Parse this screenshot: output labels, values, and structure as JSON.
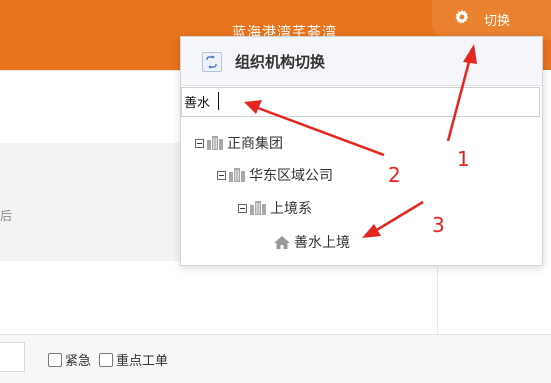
{
  "header": {
    "project_title": "蓝海港湾芊荟湾",
    "switch_label": "切换"
  },
  "background": {
    "left_text": "后",
    "checkboxes": [
      {
        "label": "紧急",
        "checked": false
      },
      {
        "label": "重点工单",
        "checked": false
      }
    ]
  },
  "org_panel": {
    "title": "组织机构切换",
    "search": {
      "value": "善水",
      "placeholder": ""
    },
    "tree": [
      {
        "label": "正商集团",
        "icon": "building-icon",
        "expanded": true
      },
      {
        "label": "华东区域公司",
        "icon": "building-icon",
        "expanded": true
      },
      {
        "label": "上境系",
        "icon": "building-icon",
        "expanded": true
      },
      {
        "label": "善水上境",
        "icon": "house-icon",
        "expanded": false
      }
    ]
  },
  "annotations": {
    "labels": [
      "1",
      "2",
      "3"
    ],
    "color": "#e5261e"
  },
  "colors": {
    "header": "#e8731c",
    "switch_button": "#e9812e"
  }
}
